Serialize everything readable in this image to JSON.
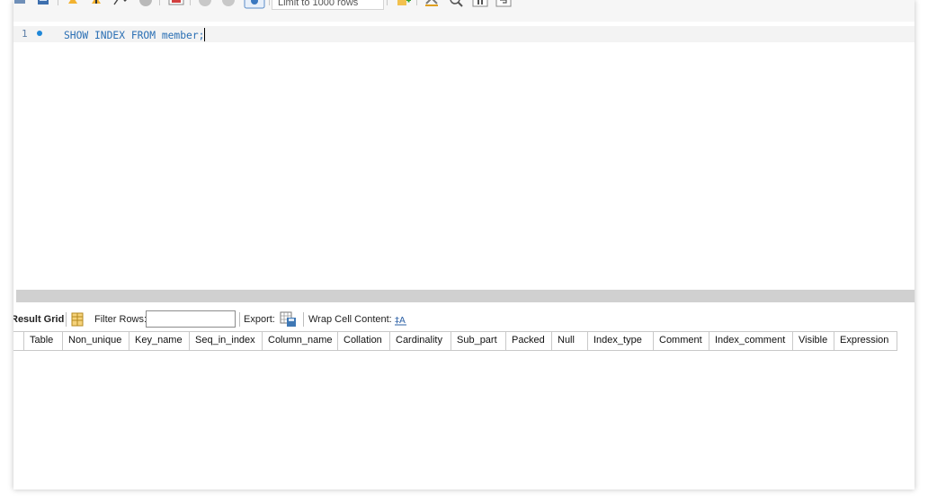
{
  "toolbar": {
    "limit_select": "Limit to 1000 rows",
    "icons": [
      "open-file-icon",
      "save-icon",
      "execute-icon",
      "execute-current-icon",
      "explain-icon",
      "stop-icon",
      "toggle-error-icon",
      "commit-icon",
      "rollback-icon",
      "autocommit-icon",
      "add-snippet-icon",
      "beautify-icon",
      "find-icon",
      "invisible-chars-icon",
      "wrap-icon"
    ]
  },
  "editor": {
    "line_number": "1",
    "query": "SHOW INDEX FROM member;"
  },
  "result": {
    "grid_label": "Result Grid",
    "filter_label": "Filter Rows:",
    "filter_value": "",
    "export_label": "Export:",
    "wrap_label": "Wrap Cell Content:",
    "columns": [
      "Table",
      "Non_unique",
      "Key_name",
      "Seq_in_index",
      "Column_name",
      "Collation",
      "Cardinality",
      "Sub_part",
      "Packed",
      "Null",
      "Index_type",
      "Comment",
      "Index_comment",
      "Visible",
      "Expression"
    ],
    "rows": []
  },
  "colors": {
    "keyword": "#2a6fb4",
    "line_highlight": "#f3f3f3",
    "splitter": "#d0d0d0",
    "breakpoint": "#1f87d8"
  }
}
